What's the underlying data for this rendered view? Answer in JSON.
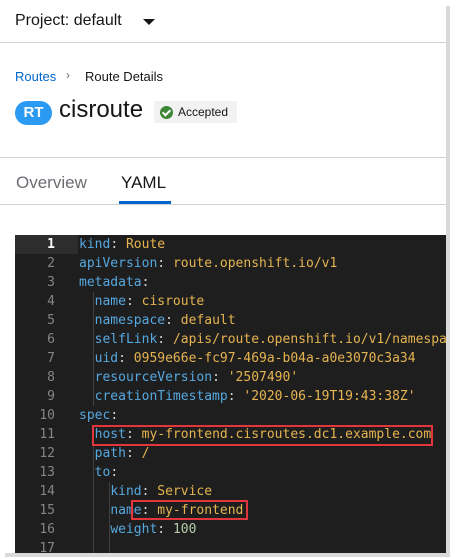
{
  "topbar": {
    "project_label": "Project: default"
  },
  "breadcrumb": {
    "parent": "Routes",
    "separator": "›",
    "current": "Route Details"
  },
  "resource": {
    "badge": "RT",
    "name": "cisroute",
    "status": "Accepted"
  },
  "tabs": [
    {
      "label": "Overview"
    },
    {
      "label": "YAML"
    }
  ],
  "colors": {
    "accent": "#0066cc",
    "badge": "#2b9af3",
    "success": "#3e8635",
    "highlight": "#e2363c"
  },
  "yaml": {
    "lines": [
      {
        "n": "1",
        "indent": "",
        "key": "kind",
        "sep": ": ",
        "val": "Route",
        "vtype": "v"
      },
      {
        "n": "2",
        "indent": "",
        "key": "apiVersion",
        "sep": ": ",
        "val": "route.openshift.io/v1",
        "vtype": "v"
      },
      {
        "n": "3",
        "indent": "",
        "key": "metadata",
        "sep": ":",
        "val": "",
        "vtype": "v"
      },
      {
        "n": "4",
        "indent": "  ",
        "key": "name",
        "sep": ": ",
        "val": "cisroute",
        "vtype": "v"
      },
      {
        "n": "5",
        "indent": "  ",
        "key": "namespace",
        "sep": ": ",
        "val": "default",
        "vtype": "v"
      },
      {
        "n": "6",
        "indent": "  ",
        "key": "selfLink",
        "sep": ": ",
        "val": "/apis/route.openshift.io/v1/namespa",
        "vtype": "v"
      },
      {
        "n": "7",
        "indent": "  ",
        "key": "uid",
        "sep": ": ",
        "val": "0959e66e-fc97-469a-b04a-a0e3070c3a34",
        "vtype": "v"
      },
      {
        "n": "8",
        "indent": "  ",
        "key": "resourceVersion",
        "sep": ": ",
        "val": "'2507490'",
        "vtype": "s"
      },
      {
        "n": "9",
        "indent": "  ",
        "key": "creationTimestamp",
        "sep": ": ",
        "val": "'2020-06-19T19:43:38Z'",
        "vtype": "s"
      },
      {
        "n": "10",
        "indent": "",
        "key": "spec",
        "sep": ":",
        "val": "",
        "vtype": "v"
      },
      {
        "n": "11",
        "indent": "  ",
        "key": "host",
        "sep": ": ",
        "val": "my-frontend.cisroutes.dc1.example.com",
        "vtype": "v"
      },
      {
        "n": "12",
        "indent": "  ",
        "key": "path",
        "sep": ": ",
        "val": "/",
        "vtype": "v"
      },
      {
        "n": "13",
        "indent": "  ",
        "key": "to",
        "sep": ":",
        "val": "",
        "vtype": "v"
      },
      {
        "n": "14",
        "indent": "    ",
        "key": "kind",
        "sep": ": ",
        "val": "Service",
        "vtype": "v"
      },
      {
        "n": "15",
        "indent": "    ",
        "key": "name",
        "sep": ": ",
        "val": "my-frontend",
        "vtype": "v"
      },
      {
        "n": "16",
        "indent": "    ",
        "key": "weight",
        "sep": ": ",
        "val": "100",
        "vtype": "n"
      },
      {
        "n": "17",
        "indent": "",
        "key": "",
        "sep": "",
        "val": "",
        "vtype": "v"
      }
    ],
    "active_line": "1"
  }
}
